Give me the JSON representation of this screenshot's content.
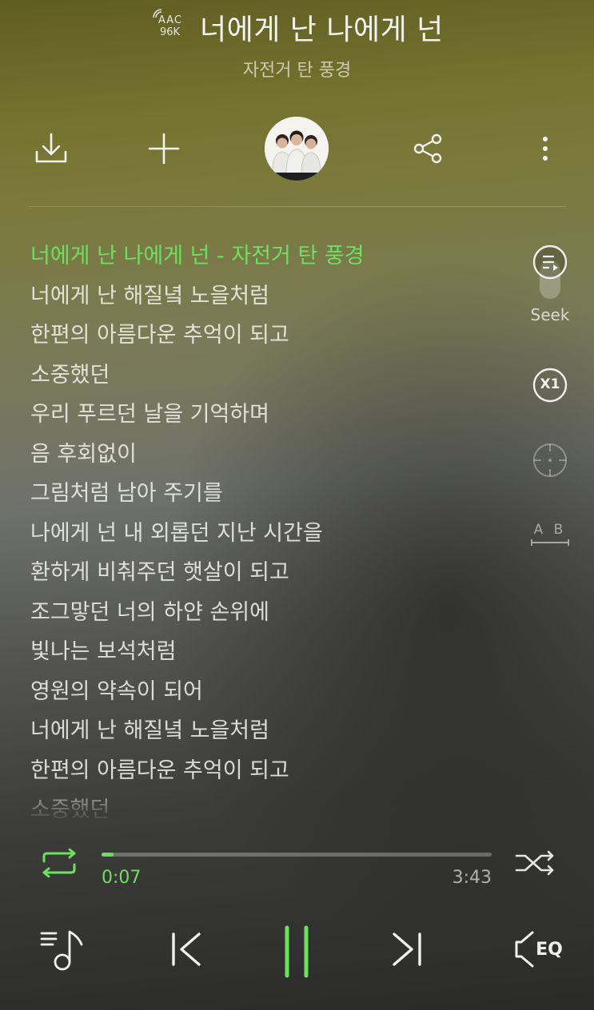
{
  "header": {
    "quality_codec": "AAC",
    "quality_bitrate": "96K",
    "song_title": "너에게 난 나에게 넌",
    "artist": "자전거 탄 풍경"
  },
  "toolbar": {
    "icons": [
      "download-icon",
      "add-icon",
      "album-art",
      "share-icon",
      "more-icon"
    ]
  },
  "lyrics": {
    "lines": [
      "너에게 난 나에게 넌 - 자전거 탄 풍경",
      "너에게 난 해질녘 노을처럼",
      "한편의 아름다운 추억이 되고",
      "소중했던",
      "우리 푸르던 날을 기억하며",
      "음 후회없이",
      "그림처럼 남아 주기를",
      "나에게 넌 내 외롭던 지난 시간을",
      "환하게 비춰주던 햇살이 되고",
      "조그맣던 너의 하얀 손위에",
      "빛나는 보석처럼",
      "영원의 약속이 되어",
      "너에게 난 해질녘 노을처럼",
      "한편의 아름다운 추억이 되고",
      "소중했던"
    ],
    "active_index": 0
  },
  "side_controls": {
    "seek_label": "Seek",
    "speed_label": "X1",
    "ab_label": "A B"
  },
  "player": {
    "elapsed": "0:07",
    "total": "3:43",
    "progress_fraction": 0.03
  },
  "bottom": {
    "eq_label": "EQ"
  },
  "colors": {
    "accent": "#6ee05f",
    "text": "#eaeaea"
  }
}
